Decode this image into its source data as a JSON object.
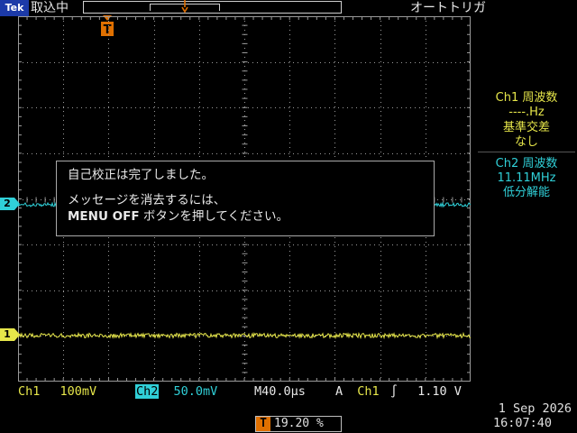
{
  "top_bar": {
    "brand": "Tek",
    "acquisition_state": "取込中",
    "trigger_status": "オートトリガ"
  },
  "markers": {
    "trigger_position": "T",
    "ch2_marker": "2",
    "ch1_marker": "1"
  },
  "side_panel": {
    "ch1_title": "Ch1 周波数",
    "ch1_value": "----.Hz",
    "ch1_note1": "基準交差",
    "ch1_note2": "なし",
    "ch2_title": "Ch2 周波数",
    "ch2_value": "11.11MHz",
    "ch2_note": "低分解能"
  },
  "message": {
    "line1": "自己校正は完了しました。",
    "line2": "メッセージを消去するには、",
    "line3_key": "MENU OFF",
    "line3_rest": " ボタンを押してください。"
  },
  "bottom": {
    "ch1_label": "Ch1",
    "ch1_scale": "100mV",
    "ch2_label": "Ch2",
    "ch2_scale": "50.0mV",
    "time_label": "M",
    "time_scale": "40.0µs",
    "trigger_mode": "A",
    "trigger_source": "Ch1",
    "trigger_slope": "∫",
    "trigger_level": "1.10 V",
    "position_marker": "T",
    "position_value": "19.20 %",
    "date": "1 Sep  2026",
    "time": "16:07:40"
  },
  "colors": {
    "ch1": "#e6e64a",
    "ch2": "#30d0d8",
    "trigger": "#e07000",
    "grid": "#9a9a9a"
  }
}
